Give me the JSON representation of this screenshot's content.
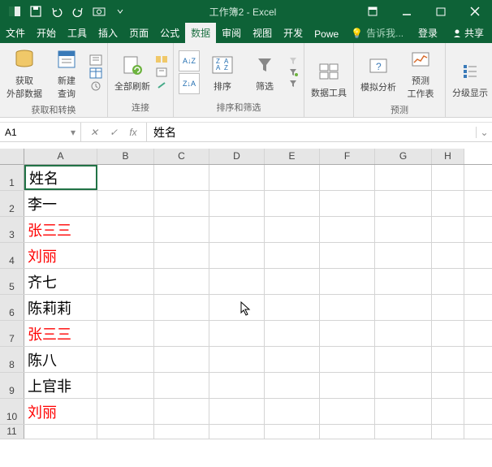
{
  "titlebar": {
    "title": "工作簿2 - Excel"
  },
  "menubar": {
    "file": "文件",
    "tabs": [
      "开始",
      "工具",
      "插入",
      "页面",
      "公式",
      "数据",
      "审阅",
      "视图",
      "开发",
      "Powe"
    ],
    "active_index": 5,
    "tell_me": "告诉我...",
    "login": "登录",
    "share": "共享"
  },
  "ribbon": {
    "g1": {
      "btn1": "获取\n外部数据",
      "btn2": "新建\n查询",
      "label": "获取和转换"
    },
    "g2": {
      "btn": "全部刷新",
      "label": "连接"
    },
    "g3": {
      "btn": "排序",
      "filter": "筛选",
      "label": "排序和筛选"
    },
    "g4": {
      "btn": "数据工具"
    },
    "g5": {
      "btn1": "模拟分析",
      "btn2": "预测\n工作表",
      "label": "预测"
    },
    "g6": {
      "btn": "分级显示"
    }
  },
  "namebox": {
    "ref": "A1",
    "formula": "姓名"
  },
  "columns": [
    "A",
    "B",
    "C",
    "D",
    "E",
    "F",
    "G",
    "H"
  ],
  "rows": [
    {
      "n": "1",
      "a": "姓名",
      "red": false
    },
    {
      "n": "2",
      "a": "李一",
      "red": false
    },
    {
      "n": "3",
      "a": "张三三",
      "red": true
    },
    {
      "n": "4",
      "a": "刘丽",
      "red": true
    },
    {
      "n": "5",
      "a": "齐七",
      "red": false
    },
    {
      "n": "6",
      "a": "陈莉莉",
      "red": false
    },
    {
      "n": "7",
      "a": "张三三",
      "red": true
    },
    {
      "n": "8",
      "a": "陈八",
      "red": false
    },
    {
      "n": "9",
      "a": "上官非",
      "red": false
    },
    {
      "n": "10",
      "a": "刘丽",
      "red": true
    },
    {
      "n": "11",
      "a": "",
      "red": false
    }
  ]
}
